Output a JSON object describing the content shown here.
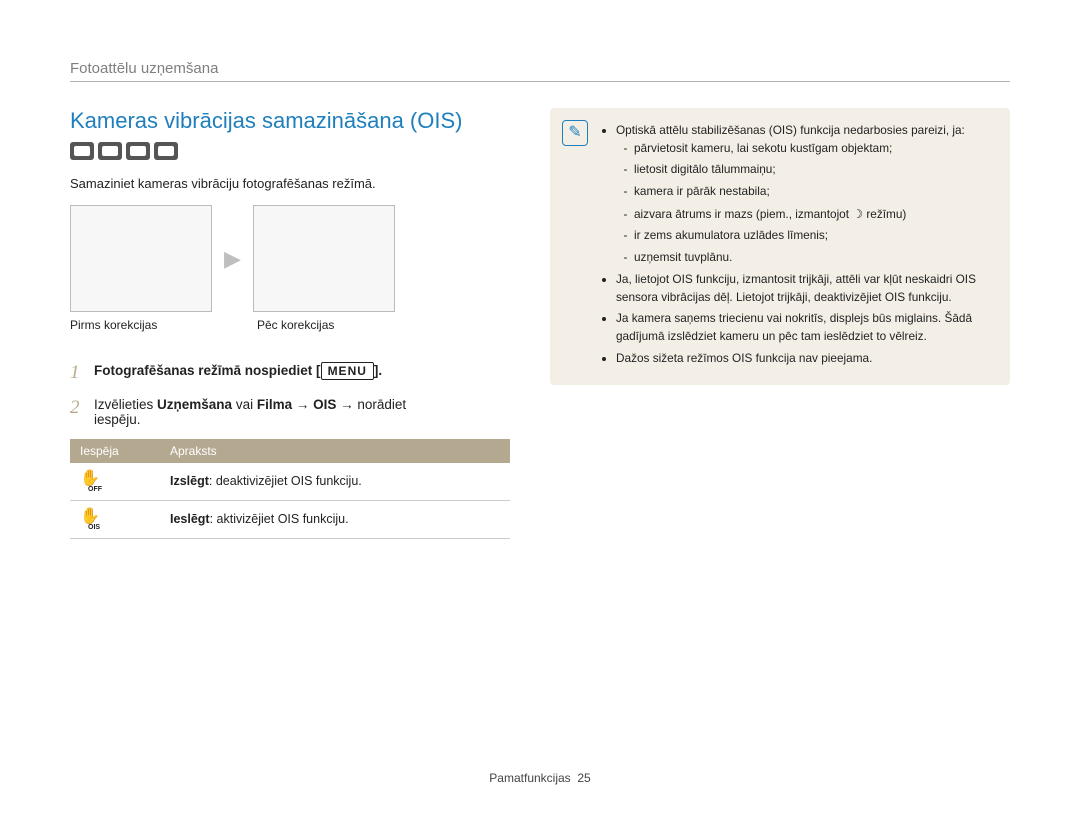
{
  "header": {
    "section": "Fotoattēlu uzņemšana"
  },
  "title": "Kameras vibrācijas samazināšana (OIS)",
  "lead": "Samaziniet kameras vibrāciju fotografēšanas režīmā.",
  "compare": {
    "before": "Pirms korekcijas",
    "after": "Pēc korekcijas"
  },
  "steps": {
    "s1": {
      "num": "1",
      "text": "Fotografēšanas režīmā nospiediet [",
      "btn": "MENU",
      "after": "]."
    },
    "s2": {
      "num": "2",
      "line1_a": "Izvēlieties ",
      "line1_b": "Uzņemšana",
      "line1_c": " vai ",
      "line1_d": "Filma",
      "line1_e": " → ",
      "line1_f": "OIS",
      "line1_g": " → norādiet",
      "line2": "iespēju."
    }
  },
  "table": {
    "h1": "Iespēja",
    "h2": "Apraksts",
    "rows": [
      {
        "icon_sub": "OFF",
        "label": "Izslēgt",
        "desc": ": deaktivizējiet OIS funkciju."
      },
      {
        "icon_sub": "OIS",
        "label": "Ieslēgt",
        "desc": ": aktivizējiet OIS funkciju."
      }
    ]
  },
  "notes": {
    "l1": "Optiskā attēlu stabilizēšanas (OIS) funkcija nedarbosies pareizi, ja:",
    "s1": "pārvietosit kameru, lai sekotu kustīgam objektam;",
    "s2": "lietosit digitālo tālummaiņu;",
    "s3": "kamera ir pārāk nestabila;",
    "s4_a": "aizvara ātrums ir mazs (piem., izmantojot ",
    "s4_b": " režīmu)",
    "s5": "ir zems akumulatora uzlādes līmenis;",
    "s6": "uzņemsit tuvplānu.",
    "l2": "Ja, lietojot OIS funkciju, izmantosit trijkāji, attēli var kļūt neskaidri OIS sensora vibrācijas dēļ. Lietojot trijkāji, deaktivizējiet OIS funkciju.",
    "l3": "Ja kamera saņems triecienu vai nokritīs, displejs būs miglains. Šādā gadījumā izslēdziet kameru un pēc tam ieslēdziet to vēlreiz.",
    "l4": "Dažos sižeta režīmos OIS funkcija nav pieejama."
  },
  "footer": {
    "label": "Pamatfunkcijas",
    "page": "25"
  }
}
